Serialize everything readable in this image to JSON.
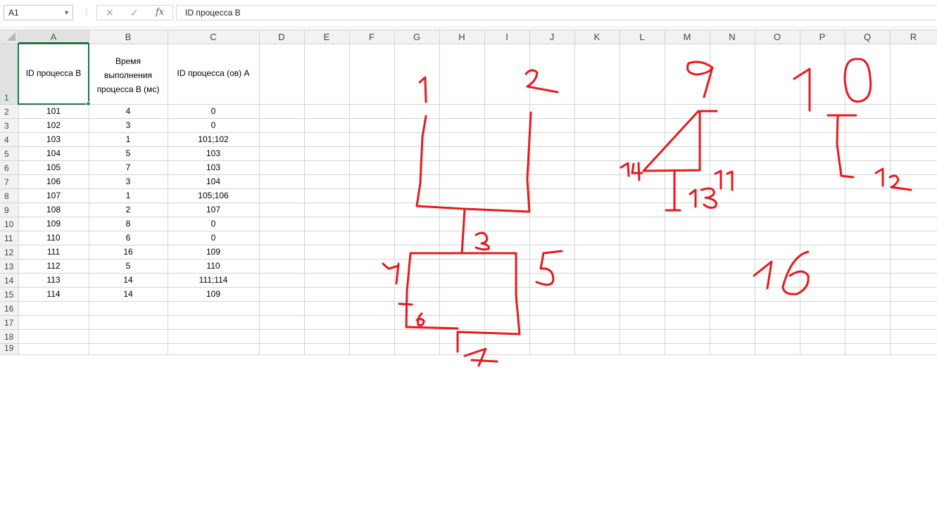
{
  "formula_bar": {
    "name_box": "A1",
    "cancel_icon": "cancel-icon",
    "enter_icon": "enter-icon",
    "function_label": "fx",
    "formula": "ID процесса B"
  },
  "columns": [
    "A",
    "B",
    "C",
    "D",
    "E",
    "F",
    "G",
    "H",
    "I",
    "J",
    "K",
    "L",
    "M",
    "N",
    "O",
    "P",
    "Q",
    "R"
  ],
  "rows": [
    "1",
    "2",
    "3",
    "4",
    "5",
    "6",
    "7",
    "8",
    "9",
    "10",
    "11",
    "12",
    "13",
    "14",
    "15",
    "16",
    "17",
    "18",
    "19"
  ],
  "header_row": {
    "a": "ID процесса B",
    "b": "Время выполнения процесса B (мс)",
    "c": "ID процесса (ов) A"
  },
  "table": [
    [
      "101",
      "4",
      "0"
    ],
    [
      "102",
      "3",
      "0"
    ],
    [
      "103",
      "1",
      "101;102"
    ],
    [
      "104",
      "5",
      "103"
    ],
    [
      "105",
      "7",
      "103"
    ],
    [
      "106",
      "3",
      "104"
    ],
    [
      "107",
      "1",
      "105;106"
    ],
    [
      "108",
      "2",
      "107"
    ],
    [
      "109",
      "8",
      "0"
    ],
    [
      "110",
      "6",
      "0"
    ],
    [
      "111",
      "16",
      "109"
    ],
    [
      "112",
      "5",
      "110"
    ],
    [
      "113",
      "14",
      "111;114"
    ],
    [
      "114",
      "14",
      "109"
    ]
  ],
  "colors": {
    "ink": "#e8191c",
    "selection": "#217346",
    "gridline": "#d4d4d4",
    "header_bg": "#f2f2f2"
  }
}
